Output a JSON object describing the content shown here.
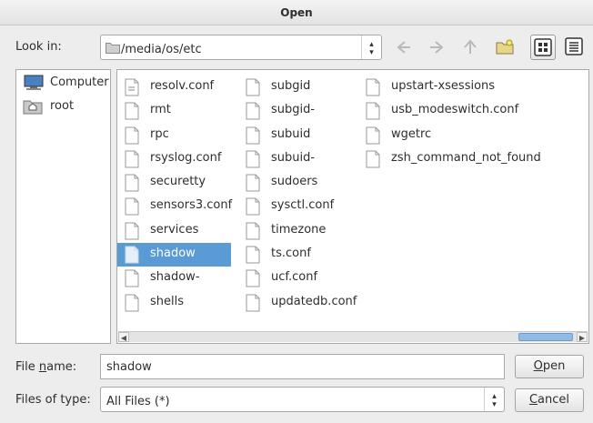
{
  "window": {
    "title": "Open"
  },
  "look_in": {
    "label": "Look in:",
    "path": "/media/os/etc",
    "toolbar_icons": [
      "back-icon",
      "forward-icon",
      "up-icon",
      "new-folder-icon",
      "icon-view-icon",
      "detail-view-icon"
    ]
  },
  "sidebar": {
    "items": [
      {
        "label": "Computer",
        "icon": "computer-icon"
      },
      {
        "label": "root",
        "icon": "home-folder-icon"
      }
    ]
  },
  "files": {
    "selected": "shadow",
    "columns": [
      [
        "resolv.conf",
        "rmt",
        "rpc",
        "rsyslog.conf",
        "securetty",
        "sensors3.conf",
        "services",
        "shadow",
        "shadow-",
        "shells"
      ],
      [
        "subgid",
        "subgid-",
        "subuid",
        "subuid-",
        "sudoers",
        "sysctl.conf",
        "timezone",
        "ts.conf",
        "ucf.conf",
        "updatedb.conf"
      ],
      [
        "upstart-xsessions",
        "usb_modeswitch.conf",
        "wgetrc",
        "zsh_command_not_found"
      ]
    ]
  },
  "file_name": {
    "label_pre": "File ",
    "label_u": "n",
    "label_post": "ame:",
    "value": "shadow"
  },
  "file_type": {
    "label": "Files of type:",
    "value": "All Files (*)"
  },
  "buttons": {
    "open_u": "O",
    "open_rest": "pen",
    "cancel_u": "C",
    "cancel_rest": "ancel"
  }
}
